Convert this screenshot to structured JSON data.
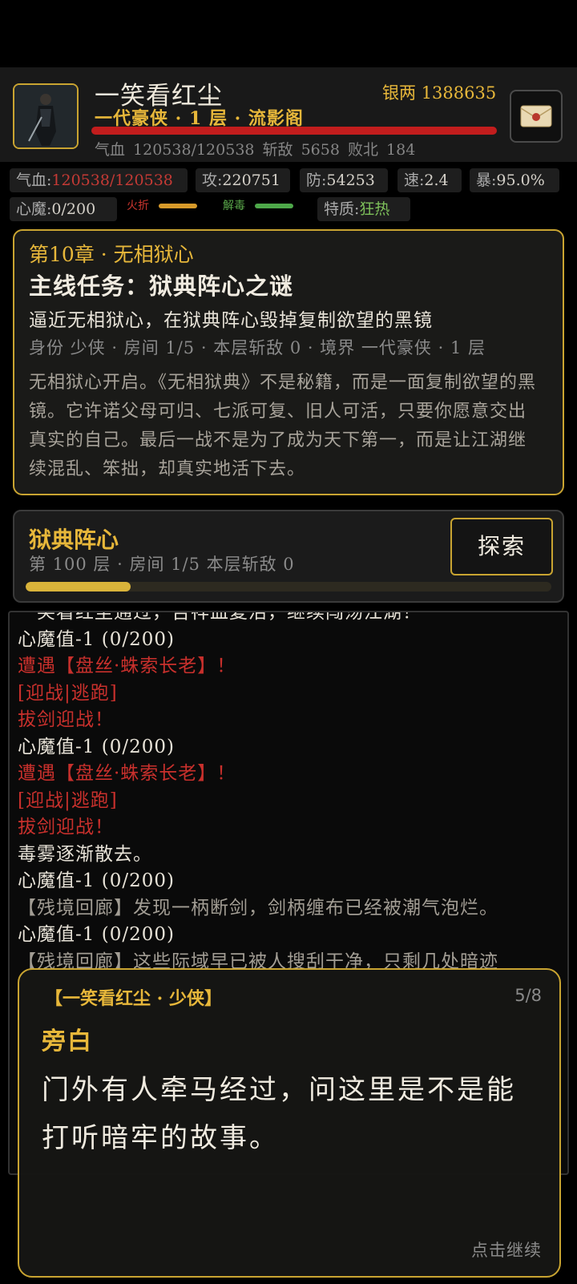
{
  "hero": {
    "name": "一笑看红尘",
    "rank": "一代豪侠 · 1 层 · 流影阁",
    "stats_line": "气血 120538/120538  斩敌 5658  败北 184",
    "silver_label": "银两",
    "silver_value": "1388635",
    "hp_fraction": 1.0
  },
  "attributes": {
    "hp_label": "气血:",
    "hp_value": "120538/120538",
    "atk_label": "攻:",
    "atk_value": "220751",
    "def_label": "防:",
    "def_value": "54253",
    "spd_label": "速:",
    "spd_value": "2.4",
    "crit_label": "暴:",
    "crit_value": "95.0%",
    "demon_label": "心魔:",
    "demon_value": "0/200",
    "fire_label": "火折",
    "antidote_label": "解毒",
    "trait_label": "特质:",
    "trait_value": "狂热"
  },
  "colors": {
    "gold": "#e7b73a",
    "red": "#c8302c",
    "green": "#7dbf5a",
    "orange": "#d79a2a"
  },
  "chapter": {
    "title": "第10章 · 无相狱心",
    "quest": "主线任务：狱典阵心之谜",
    "goal": "逼近无相狱心，在狱典阵心毁掉复制欲望的黑镜",
    "meta": "身份 少侠 · 房间 1/5 · 本层斩敌 0 · 境界 一代豪侠 · 1 层",
    "story": "无相狱心开启。《无相狱典》不是秘籍，而是一面复制欲望的黑镜。它许诺父母可归、七派可复、旧人可活，只要你愿意交出真实的自己。最后一战不是为了成为天下第一，而是让江湖继续混乱、笨拙，却真实地活下去。"
  },
  "location": {
    "name": "狱典阵心",
    "info": "第 100 层 · 房间 1/5  本层斩敌 0",
    "explore_label": "探索",
    "progress": 0.2
  },
  "log": [
    {
      "text": "一笑看红尘通过，吉祥血复活，继续闯荡江湖！",
      "color": "white"
    },
    {
      "text": "心魔值-1 (0/200)",
      "color": "white"
    },
    {
      "text": "遭遇【盘丝·蛛索长老】！",
      "color": "red"
    },
    {
      "text": "[迎战|逃跑]",
      "color": "red"
    },
    {
      "text": "拔剑迎战！",
      "color": "red"
    },
    {
      "text": "心魔值-1 (0/200)",
      "color": "white"
    },
    {
      "text": "遭遇【盘丝·蛛索长老】！",
      "color": "red"
    },
    {
      "text": "[迎战|逃跑]",
      "color": "red"
    },
    {
      "text": "拔剑迎战！",
      "color": "red"
    },
    {
      "text": "毒雾逐渐散去。",
      "color": "white"
    },
    {
      "text": "心魔值-1 (0/200)",
      "color": "white"
    },
    {
      "text": "【残境回廊】发现一柄断剑，剑柄缠布已经被潮气泡烂。",
      "color": "grey"
    },
    {
      "text": "心魔值-1 (0/200)",
      "color": "white"
    },
    {
      "text": "【残境回廊】这些际域早已被人搜刮干净，只剩几处暗迹",
      "color": "grey"
    }
  ],
  "dialog": {
    "speaker": "【一笑看红尘 · 少侠】",
    "page": "5/8",
    "role": "旁白",
    "text": "门外有人牵马经过，问这里是不是能打听暗牢的故事。",
    "continue": "点击继续"
  }
}
